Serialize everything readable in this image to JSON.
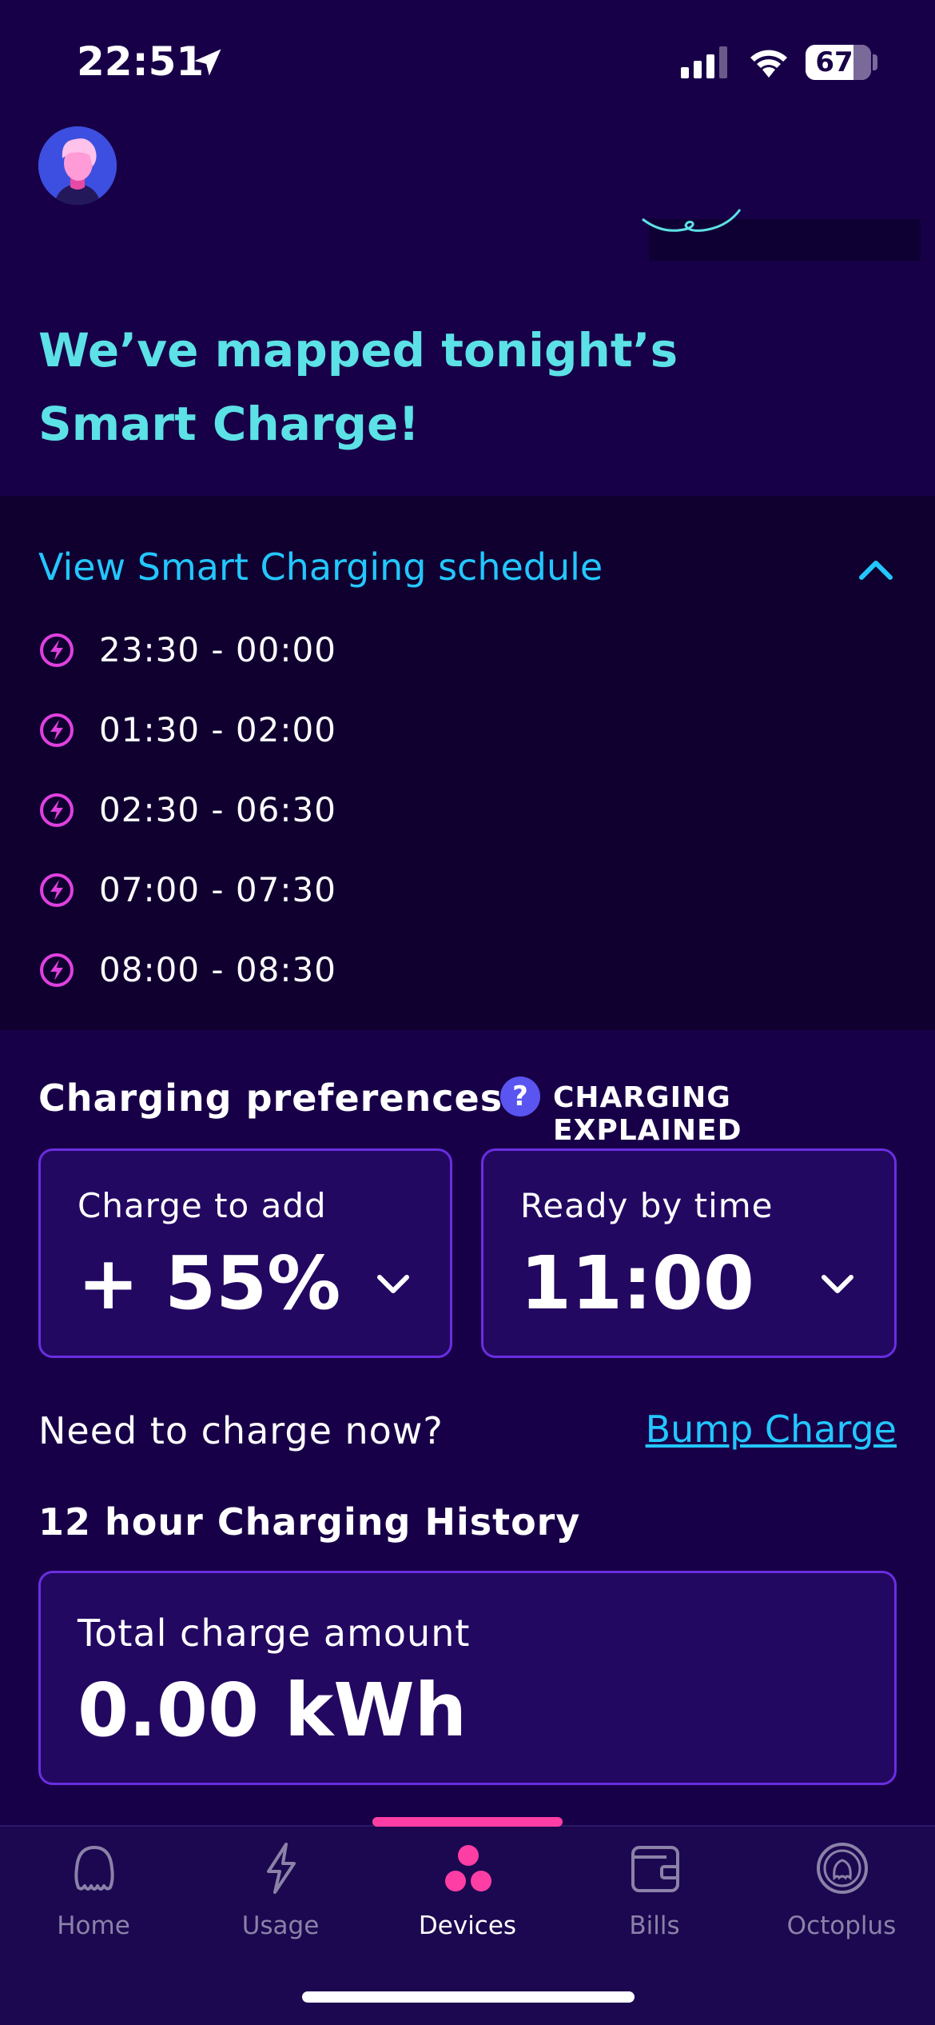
{
  "status_bar": {
    "time": "22:51",
    "battery": "67"
  },
  "hero": {
    "title_line1": "We’ve mapped tonight’s",
    "title_line2": "Smart Charge!"
  },
  "schedule": {
    "title": "View Smart Charging schedule",
    "slots": [
      "23:30 - 00:00",
      "01:30 - 02:00",
      "02:30 - 06:30",
      "07:00 - 07:30",
      "08:00 - 08:30"
    ]
  },
  "preferences": {
    "title": "Charging preferences",
    "explain_label": "CHARGING EXPLAINED",
    "help_symbol": "?",
    "charge_card": {
      "label": "Charge to add",
      "value": "+ 55%"
    },
    "ready_card": {
      "label": "Ready by time",
      "value": "11:00"
    }
  },
  "bump": {
    "question": "Need to charge now?",
    "link": "Bump Charge"
  },
  "history": {
    "title": "12 hour Charging History",
    "label": "Total charge amount",
    "value": "0.00 kWh"
  },
  "tabs": [
    {
      "label": "Home",
      "icon": "octopus-icon"
    },
    {
      "label": "Usage",
      "icon": "lightning-icon"
    },
    {
      "label": "Devices",
      "icon": "devices-icon",
      "active": true
    },
    {
      "label": "Bills",
      "icon": "wallet-icon"
    },
    {
      "label": "Octoplus",
      "icon": "octoplus-icon"
    }
  ],
  "colors": {
    "background": "#180048",
    "accent_cyan": "#5ce1e6",
    "link_blue": "#23c7ff",
    "bolt_pink": "#e040e0",
    "active_indicator": "#ff3ea5"
  }
}
